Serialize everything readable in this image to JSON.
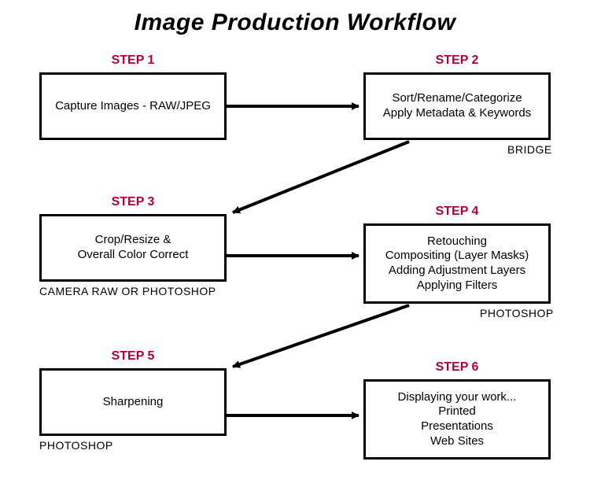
{
  "title": "Image Production Workflow",
  "steps": [
    {
      "label": "STEP 1",
      "lines": [
        "Capture Images - RAW/JPEG"
      ],
      "tool": ""
    },
    {
      "label": "STEP 2",
      "lines": [
        "Sort/Rename/Categorize",
        "Apply Metadata & Keywords"
      ],
      "tool": "BRIDGE"
    },
    {
      "label": "STEP 3",
      "lines": [
        "Crop/Resize &",
        "Overall Color Correct"
      ],
      "tool": "CAMERA RAW OR PHOTOSHOP"
    },
    {
      "label": "STEP 4",
      "lines": [
        "Retouching",
        "Compositing (Layer Masks)",
        "Adding Adjustment Layers",
        "Applying Filters"
      ],
      "tool": "PHOTOSHOP"
    },
    {
      "label": "STEP 5",
      "lines": [
        "Sharpening"
      ],
      "tool": "PHOTOSHOP"
    },
    {
      "label": "STEP 6",
      "lines": [
        "Displaying your work...",
        "Printed",
        "Presentations",
        "Web Sites"
      ],
      "tool": ""
    }
  ],
  "colors": {
    "step_label": "#b3003b",
    "border": "#000000"
  }
}
